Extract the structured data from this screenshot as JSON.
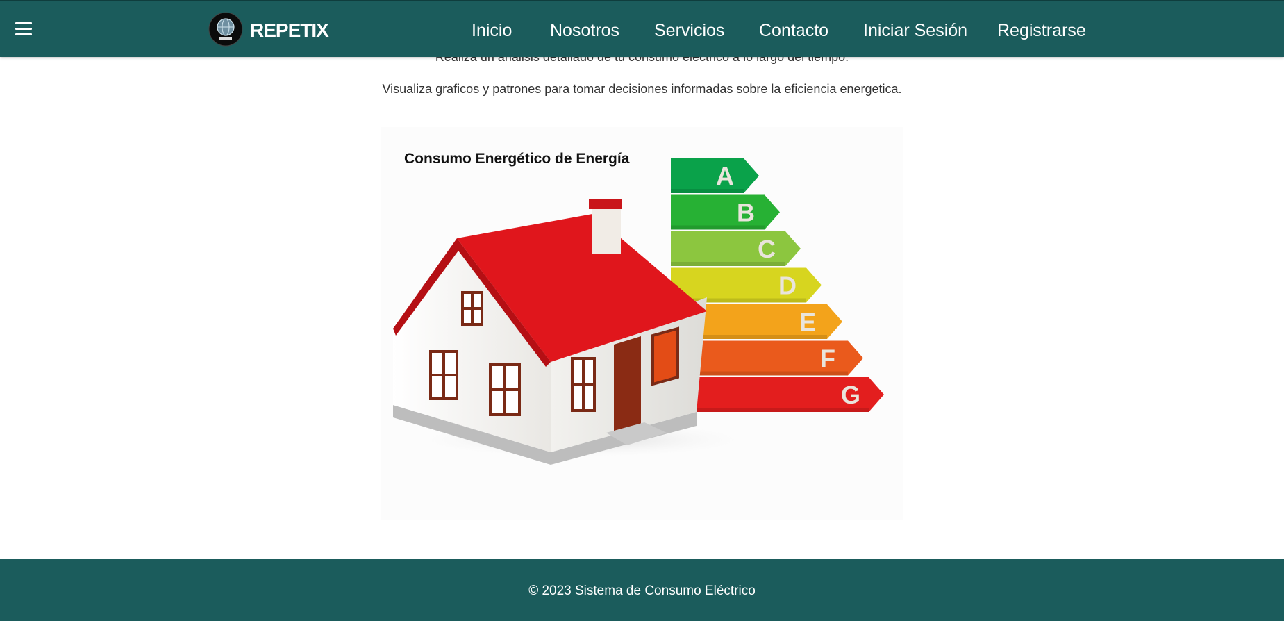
{
  "header": {
    "brand": "REPETIX",
    "menu_icon": "hamburger-menu-icon",
    "logo_icon": "globe-logo-icon",
    "nav": [
      {
        "label": "Inicio"
      },
      {
        "label": "Nosotros"
      },
      {
        "label": "Servicios"
      },
      {
        "label": "Contacto"
      },
      {
        "label": "Iniciar Sesión"
      },
      {
        "label": "Registrarse"
      }
    ]
  },
  "main": {
    "intro_line": "Realiza un análisis detallado de tu consumo eléctrico a lo largo del tiempo.",
    "description": "Visualiza graficos y patrones para tomar decisiones informadas sobre la eficiencia energetica.",
    "illustration": {
      "title": "Consumo Energético de Energía",
      "ratings": [
        "A",
        "B",
        "C",
        "D",
        "E",
        "F",
        "G"
      ],
      "rating_colors": [
        "#0aa24a",
        "#27b134",
        "#8cc63f",
        "#d7d51f",
        "#f3a31b",
        "#ea5a1c",
        "#e31e1e"
      ]
    }
  },
  "footer": {
    "text": "© 2023 Sistema de Consumo Eléctrico"
  },
  "colors": {
    "primary": "#1b5c5c",
    "roof": "#e0161c"
  }
}
